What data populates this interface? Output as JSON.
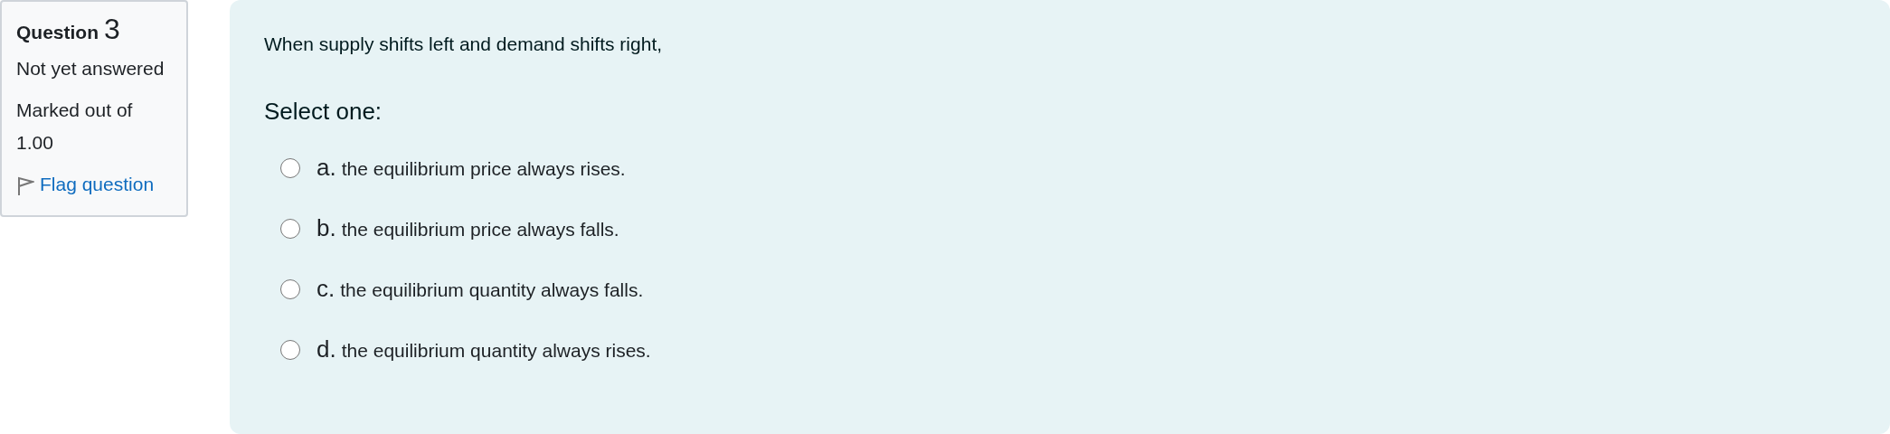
{
  "info": {
    "label": "Question",
    "number": "3",
    "status": "Not yet answered",
    "marks": "Marked out of 1.00",
    "flag": {
      "label": "Flag question",
      "flagged": false
    }
  },
  "question": {
    "text": "When supply shifts left and demand shifts right,",
    "prompt": "Select one:",
    "options": [
      {
        "letter": "a.",
        "text": "the equilibrium price always rises.",
        "selected": false
      },
      {
        "letter": "b.",
        "text": "the equilibrium price always falls.",
        "selected": false
      },
      {
        "letter": "c.",
        "text": "the equilibrium quantity always falls.",
        "selected": false
      },
      {
        "letter": "d.",
        "text": "the equilibrium quantity always rises.",
        "selected": false
      }
    ]
  }
}
